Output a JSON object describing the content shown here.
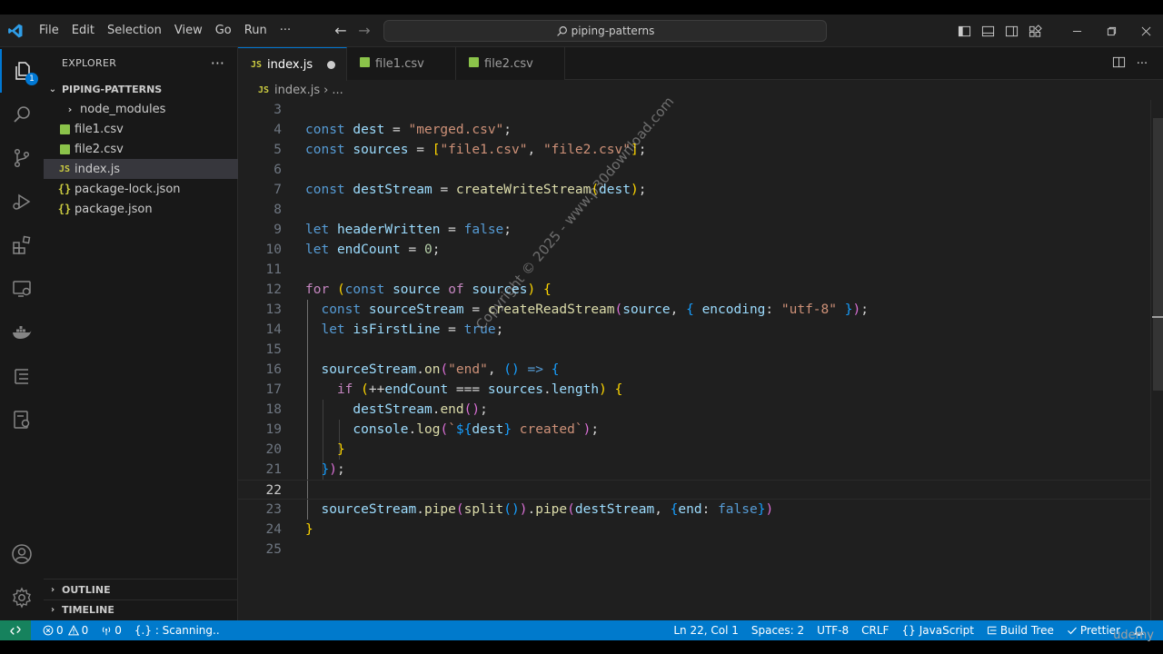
{
  "menu": [
    "File",
    "Edit",
    "Selection",
    "View",
    "Go",
    "Run",
    "···"
  ],
  "search": {
    "label": "piping-patterns"
  },
  "activity": {
    "explorer_badge": "1"
  },
  "sidebar": {
    "title": "EXPLORER",
    "more": "···",
    "project": "PIPING-PATTERNS",
    "items": [
      {
        "label": "node_modules",
        "type": "folder"
      },
      {
        "label": "file1.csv",
        "type": "csv"
      },
      {
        "label": "file2.csv",
        "type": "csv"
      },
      {
        "label": "index.js",
        "type": "js"
      },
      {
        "label": "package-lock.json",
        "type": "json"
      },
      {
        "label": "package.json",
        "type": "json"
      }
    ],
    "outline": "OUTLINE",
    "timeline": "TIMELINE"
  },
  "tabs": [
    {
      "label": "index.js",
      "icon": "JS",
      "active": true
    },
    {
      "label": "file1.csv",
      "icon": "csv",
      "active": false
    },
    {
      "label": "file2.csv",
      "icon": "csv",
      "active": false
    }
  ],
  "breadcrumb": {
    "file": "index.js",
    "rest": "..."
  },
  "code_lines": [
    "",
    "const dest = \"merged.csv\";",
    "const sources = [\"file1.csv\", \"file2.csv\"];",
    "",
    "const destStream = createWriteStream(dest);",
    "",
    "let headerWritten = false;",
    "let endCount = 0;",
    "",
    "for (const source of sources) {",
    "  const sourceStream = createReadStream(source, { encoding: \"utf-8\" });",
    "  let isFirstLine = true;",
    "",
    "  sourceStream.on(\"end\", () => {",
    "    if (++endCount === sources.length) {",
    "      destStream.end();",
    "      console.log(`${dest} created`);",
    "    }",
    "  });",
    "",
    "  sourceStream.pipe(split()).pipe(destStream, {end: false})",
    "}",
    ""
  ],
  "line_numbers": [
    "3",
    "4",
    "5",
    "6",
    "7",
    "8",
    "9",
    "10",
    "11",
    "12",
    "13",
    "14",
    "15",
    "16",
    "17",
    "18",
    "19",
    "20",
    "21",
    "22",
    "23",
    "24",
    "25"
  ],
  "current_line": "22",
  "watermark": "Copyright © 2025 - www.p30download.com",
  "status": {
    "errors": "0",
    "warnings": "0",
    "ports": "0",
    "scanning": "{.} : Scanning..",
    "position": "Ln 22, Col 1",
    "spaces": "Spaces: 2",
    "encoding": "UTF-8",
    "eol": "CRLF",
    "language": "JavaScript",
    "language_icon": "{}",
    "build_tree": "Build Tree",
    "prettier": "Prettier"
  },
  "brand": "udemy",
  "colors": {
    "accent": "#0078d4",
    "status_bar": "#007acc",
    "remote": "#16825d"
  }
}
